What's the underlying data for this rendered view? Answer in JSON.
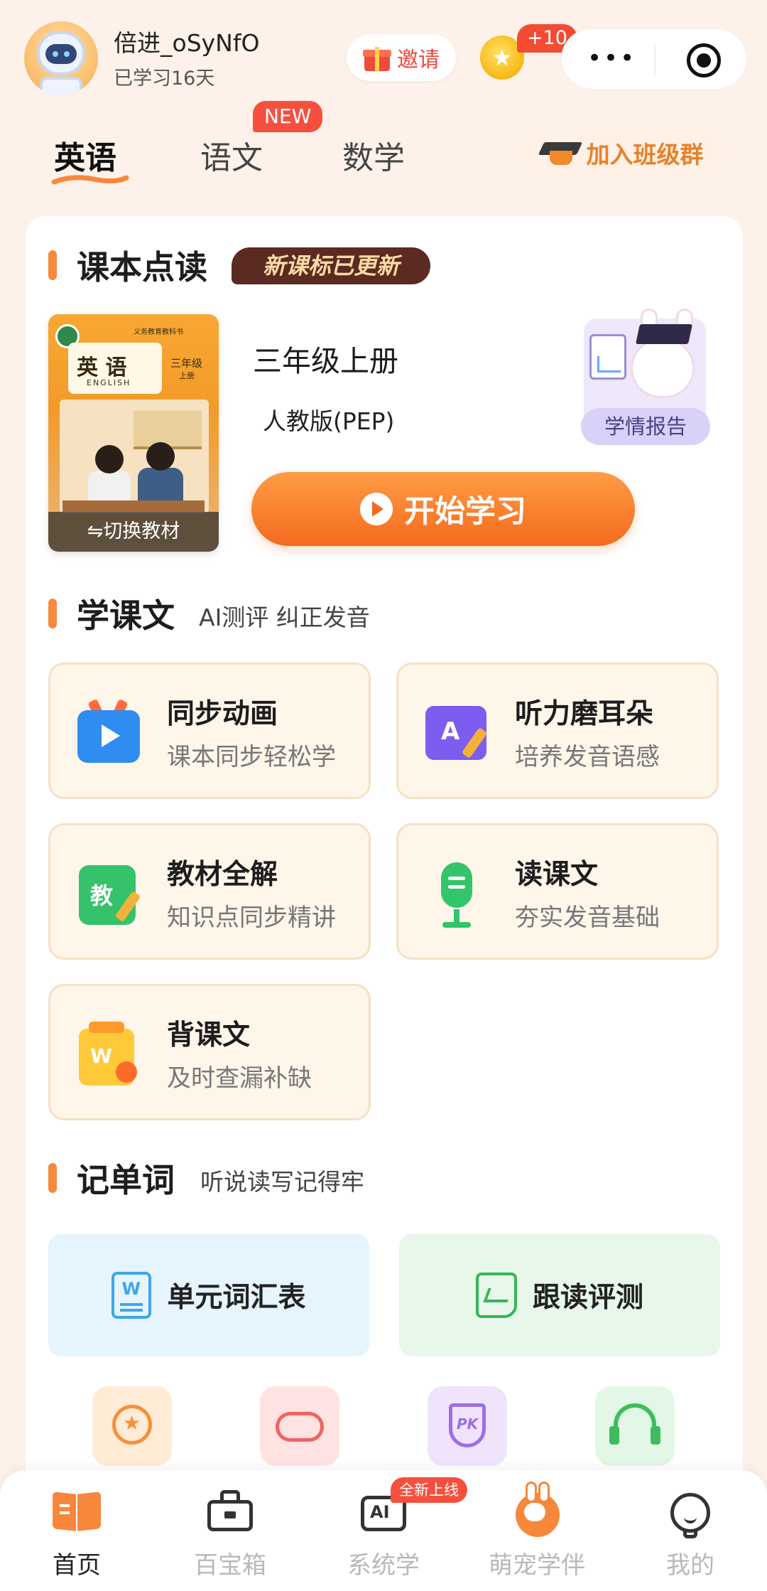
{
  "header": {
    "username": "倍进_oSyNfO",
    "study_days": "已学习16天",
    "invite_label": "邀请",
    "coin_badge": "+10"
  },
  "subject_tabs": [
    {
      "label": "英语",
      "active": true
    },
    {
      "label": "语文",
      "active": false,
      "badge": "NEW"
    },
    {
      "label": "数学",
      "active": false
    }
  ],
  "join_class_label": "加入班级群",
  "textbook": {
    "section_title": "课本点读",
    "update_badge": "新课标已更新",
    "cover": {
      "title_cn": "英 语",
      "title_en": "ENGLISH",
      "grade": "三年级",
      "term": "上册",
      "publisher_line": "义务教育教科书"
    },
    "switch_label": "⇋切换教材",
    "grade_label": "三年级上册",
    "edition_label": "人教版(PEP)",
    "report_label": "学情报告",
    "start_label": "开始学习"
  },
  "lesson_section": {
    "title": "学课文",
    "subtitle": "AI测评 纠正发音",
    "tiles": [
      {
        "title": "同步动画",
        "subtitle": "课本同步轻松学",
        "icon": "tv-play-icon"
      },
      {
        "title": "听力磨耳朵",
        "subtitle": "培养发音语感",
        "icon": "listening-icon"
      },
      {
        "title": "教材全解",
        "subtitle": "知识点同步精讲",
        "icon": "textbook-icon"
      },
      {
        "title": "读课文",
        "subtitle": "夯实发音基础",
        "icon": "microphone-icon"
      },
      {
        "title": "背课文",
        "subtitle": "及时查漏补缺",
        "icon": "recite-icon"
      }
    ],
    "icon_text": {
      "listening": "A",
      "textbook": "教",
      "recite": "W"
    }
  },
  "word_section": {
    "title": "记单词",
    "subtitle": "听说读写记得牢",
    "cards": [
      {
        "label": "单元词汇表",
        "icon": "word-doc-icon",
        "icon_text": "W"
      },
      {
        "label": "跟读评测",
        "icon": "scroll-chart-icon"
      }
    ]
  },
  "mini_icons": [
    {
      "icon": "medal-icon"
    },
    {
      "icon": "gamepad-icon"
    },
    {
      "icon": "pk-shield-icon",
      "icon_text": "PK"
    },
    {
      "icon": "headphones-icon"
    }
  ],
  "bottom_nav": [
    {
      "label": "首页",
      "active": true,
      "icon": "home-book-icon"
    },
    {
      "label": "百宝箱",
      "active": false,
      "icon": "toolbox-icon"
    },
    {
      "label": "系统学",
      "active": false,
      "icon": "ai-icon",
      "badge": "全新上线",
      "icon_text": "AI"
    },
    {
      "label": "萌宠学伴",
      "active": false,
      "icon": "bunny-icon"
    },
    {
      "label": "我的",
      "active": false,
      "icon": "profile-icon"
    }
  ],
  "colors": {
    "background": "#fdf1ea",
    "accent_orange": "#f46a1e",
    "badge_red": "#f5503e",
    "tile_bg": "#fff6ea"
  }
}
